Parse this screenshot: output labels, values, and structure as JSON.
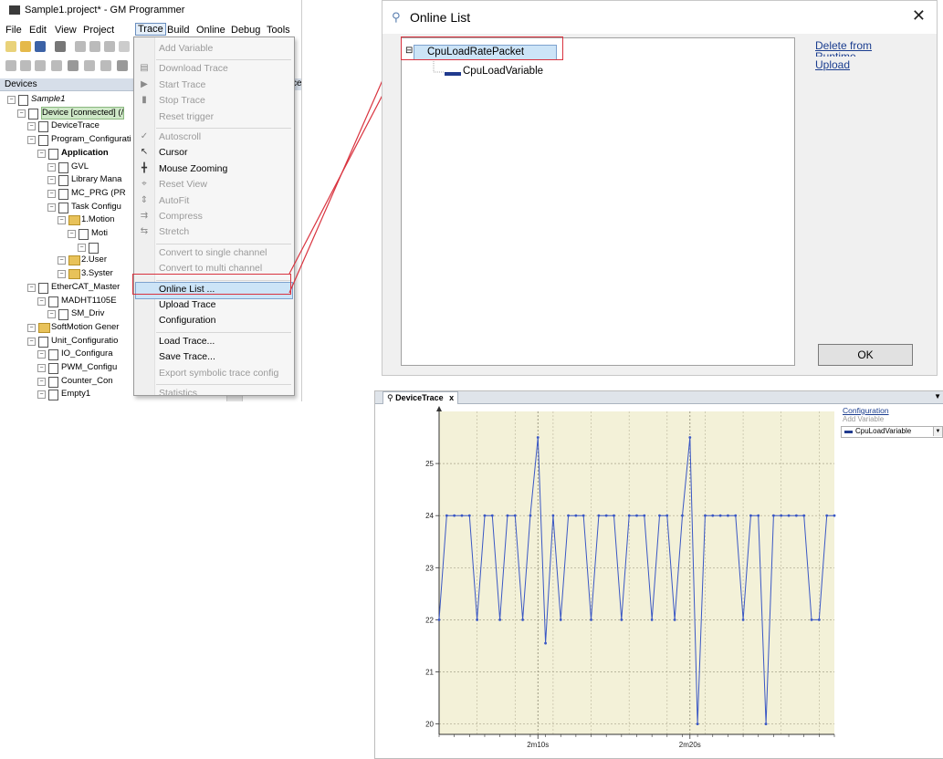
{
  "ide": {
    "title": "Sample1.project* - GM Programmer",
    "menubar": [
      "File",
      "Edit",
      "View",
      "Project",
      "Trace",
      "Build",
      "Online",
      "Debug",
      "Tools"
    ],
    "devices_header": "Devices",
    "devices_header_clip": "ce",
    "tree": [
      {
        "label": "Sample1",
        "indent": 0,
        "italic": true
      },
      {
        "label": "Device [connected] (/",
        "indent": 1,
        "highlight": true
      },
      {
        "label": "DeviceTrace",
        "indent": 2
      },
      {
        "label": "Program_Configurati",
        "indent": 2
      },
      {
        "label": "Application",
        "indent": 3,
        "bold": true
      },
      {
        "label": "GVL",
        "indent": 4
      },
      {
        "label": "Library Mana",
        "indent": 4
      },
      {
        "label": "MC_PRG (PR",
        "indent": 4
      },
      {
        "label": "Task Configu",
        "indent": 4
      },
      {
        "label": "1.Motion",
        "indent": 5
      },
      {
        "label": "Moti",
        "indent": 6
      },
      {
        "label": "",
        "indent": 7
      },
      {
        "label": "2.User",
        "indent": 5
      },
      {
        "label": "3.Syster",
        "indent": 5
      },
      {
        "label": "EtherCAT_Master",
        "indent": 2
      },
      {
        "label": "MADHT1105E",
        "indent": 3
      },
      {
        "label": "SM_Driv",
        "indent": 4
      },
      {
        "label": "SoftMotion Gener",
        "indent": 2
      },
      {
        "label": "Unit_Configuratio",
        "indent": 2
      },
      {
        "label": "IO_Configura",
        "indent": 3
      },
      {
        "label": "PWM_Configu",
        "indent": 3
      },
      {
        "label": "Counter_Con",
        "indent": 3
      },
      {
        "label": "Empty1",
        "indent": 3
      }
    ]
  },
  "trace_menu": {
    "items": [
      {
        "label": "Add Variable",
        "disabled": true,
        "icon": ""
      },
      {
        "sep": true
      },
      {
        "label": "Download Trace",
        "disabled": true,
        "icon": "▤"
      },
      {
        "label": "Start Trace",
        "disabled": true,
        "icon": "▶"
      },
      {
        "label": "Stop Trace",
        "disabled": true,
        "icon": "▮"
      },
      {
        "label": "Reset trigger",
        "disabled": true,
        "icon": ""
      },
      {
        "sep": true
      },
      {
        "label": "Autoscroll",
        "disabled": true,
        "icon": "✓"
      },
      {
        "label": "Cursor",
        "disabled": false,
        "icon": "↖"
      },
      {
        "label": "Mouse Zooming",
        "disabled": false,
        "icon": "╋"
      },
      {
        "label": "Reset View",
        "disabled": true,
        "icon": "⌖"
      },
      {
        "label": "AutoFit",
        "disabled": true,
        "icon": "⇕"
      },
      {
        "label": "Compress",
        "disabled": true,
        "icon": "⇉"
      },
      {
        "label": "Stretch",
        "disabled": true,
        "icon": "⇆"
      },
      {
        "sep": true
      },
      {
        "label": "Convert to single channel",
        "disabled": true,
        "icon": ""
      },
      {
        "label": "Convert to multi channel",
        "disabled": true,
        "icon": ""
      },
      {
        "sep": true
      },
      {
        "label": "Online List ...",
        "disabled": false,
        "icon": "",
        "highlight": true
      },
      {
        "label": "Upload Trace",
        "disabled": false,
        "icon": ""
      },
      {
        "label": "Configuration",
        "disabled": false,
        "icon": ""
      },
      {
        "sep": true
      },
      {
        "label": "Load Trace...",
        "disabled": false,
        "icon": ""
      },
      {
        "label": "Save Trace...",
        "disabled": false,
        "icon": ""
      },
      {
        "label": "Export symbolic trace config",
        "disabled": true,
        "icon": ""
      },
      {
        "sep": true
      },
      {
        "label": "Statistics",
        "disabled": true,
        "icon": ""
      }
    ]
  },
  "online_list": {
    "title": "Online List",
    "packet": "CpuLoadRatePacket",
    "variable": "CpuLoadVariable",
    "link_delete": "Delete from",
    "link_delete_2": "Runtime",
    "link_upload": "Upload",
    "ok_label": "OK",
    "close_glyph": "✕",
    "expand_glyph": "⊟"
  },
  "device_trace": {
    "tab_label": "DeviceTrace",
    "tab_close": "x",
    "configuration_link": "Configuration",
    "add_variable": "Add Variable",
    "legend_variable": "CpuLoadVariable",
    "line_color": "#3a57c4",
    "bg_color": "#f3f1d8"
  },
  "chart_data": {
    "type": "line",
    "title": "",
    "xlabel": "",
    "ylabel": "",
    "ylim": [
      19.8,
      26.0
    ],
    "yticks": [
      20,
      21,
      22,
      23,
      24,
      25
    ],
    "xtick_labels": [
      {
        "label": "2m10s",
        "index": 13
      },
      {
        "label": "2m20s",
        "index": 33
      }
    ],
    "grid": true,
    "series": [
      {
        "name": "CpuLoadVariable",
        "values": [
          22,
          24,
          24,
          24,
          24,
          22,
          24,
          24,
          22,
          24,
          24,
          22,
          24,
          25.5,
          21.55,
          24,
          22,
          24,
          24,
          24,
          22,
          24,
          24,
          24,
          22,
          24,
          24,
          24,
          22,
          24,
          24,
          22,
          24,
          25.5,
          20,
          24,
          24,
          24,
          24,
          24,
          22,
          24,
          24,
          20,
          24,
          24,
          24,
          24,
          24,
          22,
          22,
          24,
          24
        ]
      }
    ]
  }
}
